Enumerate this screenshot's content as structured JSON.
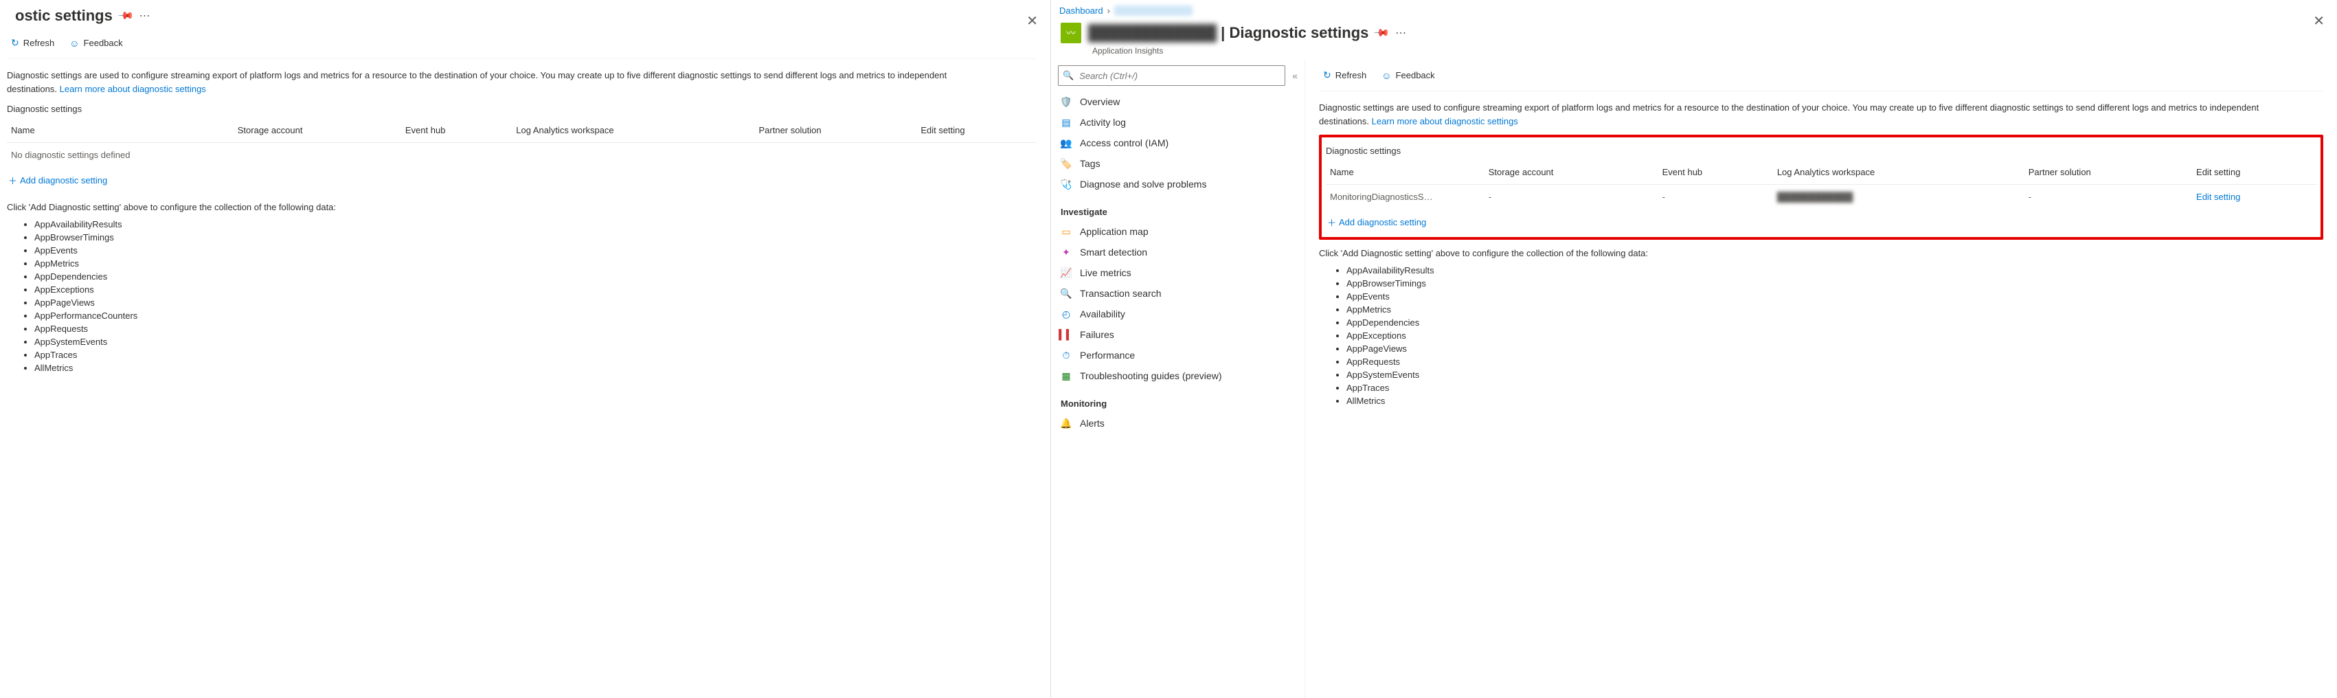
{
  "left": {
    "title_suffix": "ostic settings",
    "toolbar": {
      "refresh": "Refresh",
      "feedback": "Feedback"
    },
    "desc1": "Diagnostic settings are used to configure streaming export of platform logs and metrics for a resource to the destination of your choice. You may create up to five different diagnostic settings to send different logs and metrics to independent destinations. ",
    "learn": "Learn more about diagnostic settings",
    "section": "Diagnostic settings",
    "cols": {
      "name": "Name",
      "storage": "Storage account",
      "eh": "Event hub",
      "law": "Log Analytics workspace",
      "partner": "Partner solution",
      "edit": "Edit setting"
    },
    "empty": "No diagnostic settings defined",
    "add": "Add diagnostic setting",
    "hint": "Click 'Add Diagnostic setting' above to configure the collection of the following data:",
    "data": [
      "AppAvailabilityResults",
      "AppBrowserTimings",
      "AppEvents",
      "AppMetrics",
      "AppDependencies",
      "AppExceptions",
      "AppPageViews",
      "AppPerformanceCounters",
      "AppRequests",
      "AppSystemEvents",
      "AppTraces",
      "AllMetrics"
    ]
  },
  "right": {
    "breadcrumb": {
      "dashboard": "Dashboard",
      "resource": "████████"
    },
    "title_resource": "████████████",
    "title_sep": " | ",
    "title": "Diagnostic settings",
    "subtitle": "Application Insights",
    "search_placeholder": "Search (Ctrl+/)",
    "nav": {
      "top": [
        {
          "icon": "🛡️",
          "color": "#8661c5",
          "label": "Overview"
        },
        {
          "icon": "▤",
          "color": "#0078d4",
          "label": "Activity log"
        },
        {
          "icon": "👥",
          "color": "#0078d4",
          "label": "Access control (IAM)"
        },
        {
          "icon": "🏷️",
          "color": "#0078d4",
          "label": "Tags"
        },
        {
          "icon": "🩺",
          "color": "#0078d4",
          "label": "Diagnose and solve problems"
        }
      ],
      "investigate_hdr": "Investigate",
      "investigate": [
        {
          "icon": "▭",
          "color": "#ff8c00",
          "label": "Application map"
        },
        {
          "icon": "✦",
          "color": "#c239b3",
          "label": "Smart detection"
        },
        {
          "icon": "📈",
          "color": "#0078d4",
          "label": "Live metrics"
        },
        {
          "icon": "🔍",
          "color": "#ff8c00",
          "label": "Transaction search"
        },
        {
          "icon": "◴",
          "color": "#0078d4",
          "label": "Availability"
        },
        {
          "icon": "▍▍",
          "color": "#d13438",
          "label": "Failures"
        },
        {
          "icon": "⏱",
          "color": "#0078d4",
          "label": "Performance"
        },
        {
          "icon": "▦",
          "color": "#107c10",
          "label": "Troubleshooting guides (preview)"
        }
      ],
      "monitoring_hdr": "Monitoring",
      "monitoring": [
        {
          "icon": "🔔",
          "color": "#0078d4",
          "label": "Alerts"
        }
      ]
    },
    "toolbar": {
      "refresh": "Refresh",
      "feedback": "Feedback"
    },
    "desc1": "Diagnostic settings are used to configure streaming export of platform logs and metrics for a resource to the destination of your choice. You may create up to five different diagnostic settings to send different logs and metrics to independent destinations. ",
    "learn": "Learn more about diagnostic settings",
    "section": "Diagnostic settings",
    "cols": {
      "name": "Name",
      "storage": "Storage account",
      "eh": "Event hub",
      "law": "Log Analytics workspace",
      "partner": "Partner solution",
      "edit": "Edit setting"
    },
    "row": {
      "name": "MonitoringDiagnosticsS…",
      "storage": "-",
      "eh": "-",
      "law": "████████████",
      "partner": "-",
      "edit": "Edit setting"
    },
    "add": "Add diagnostic setting",
    "hint": "Click 'Add Diagnostic setting' above to configure the collection of the following data:",
    "data": [
      "AppAvailabilityResults",
      "AppBrowserTimings",
      "AppEvents",
      "AppMetrics",
      "AppDependencies",
      "AppExceptions",
      "AppPageViews",
      "AppRequests",
      "AppSystemEvents",
      "AppTraces",
      "AllMetrics"
    ]
  }
}
